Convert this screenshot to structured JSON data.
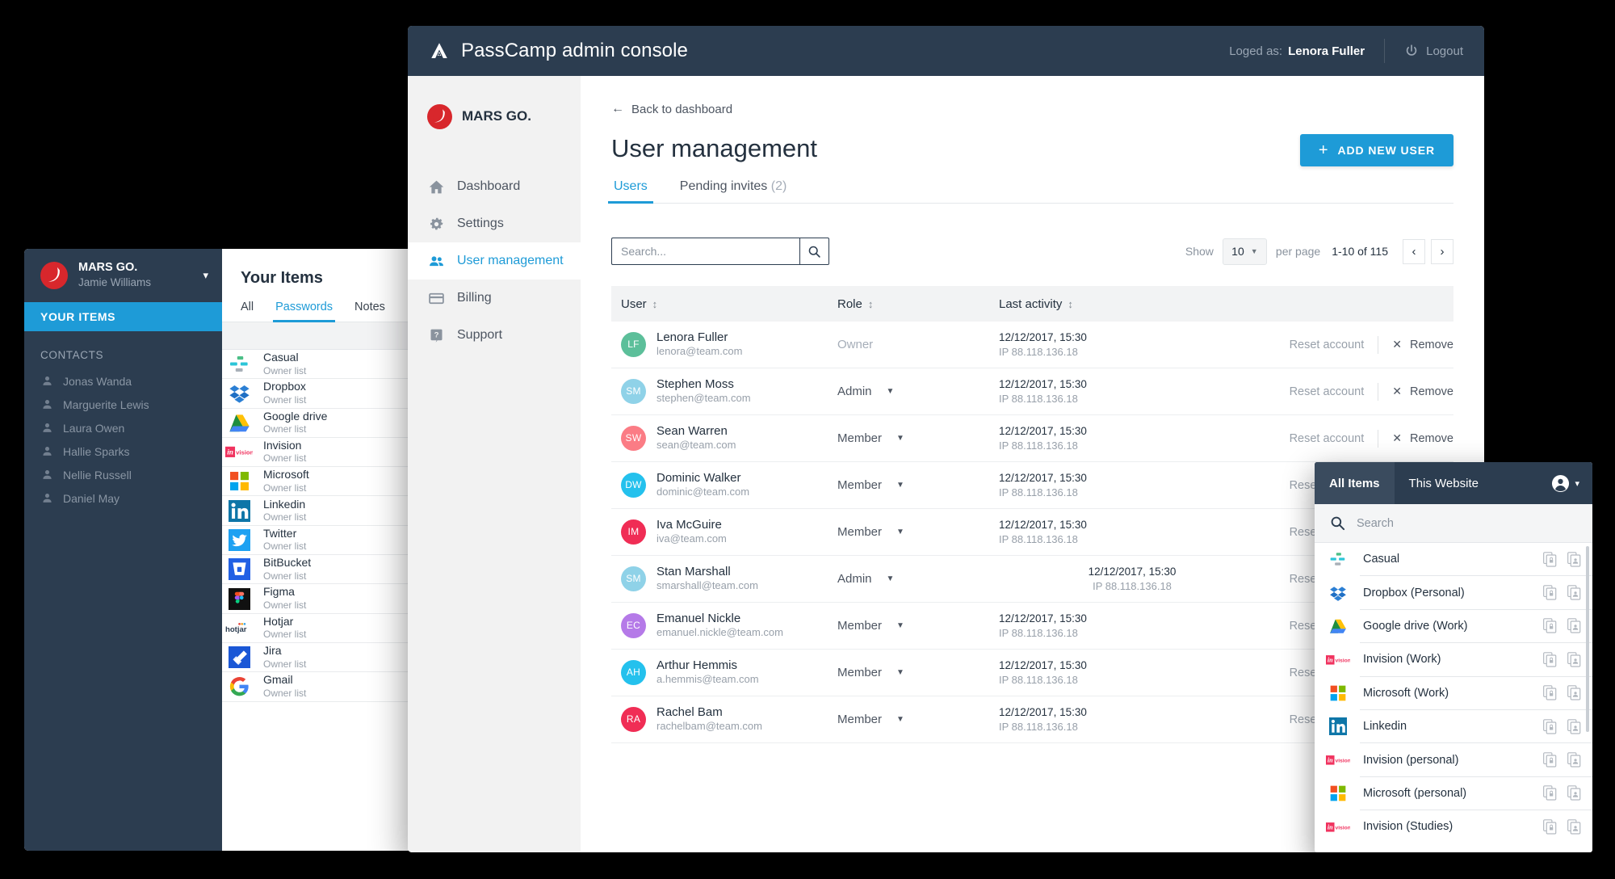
{
  "console": {
    "header": {
      "logo_icon": "passcamp-mountain-icon",
      "title": "PassCamp admin console",
      "logged_as_label": "Loged as:",
      "logged_user": "Lenora Fuller",
      "logout_label": "Logout",
      "logout_icon": "power-icon",
      "bg_color": "#2c3d50"
    },
    "sidebar": {
      "brand_name": "MARS GO.",
      "brand_logo_icon": "mars-go-logo-icon",
      "items": [
        {
          "label": "Dashboard",
          "icon": "home-icon",
          "active": false
        },
        {
          "label": "Settings",
          "icon": "gear-icon",
          "active": false
        },
        {
          "label": "User management",
          "icon": "users-icon",
          "active": true
        },
        {
          "label": "Billing",
          "icon": "credit-card-icon",
          "active": false
        },
        {
          "label": "Support",
          "icon": "question-box-icon",
          "active": false
        }
      ]
    },
    "main": {
      "back_link": "Back to dashboard",
      "back_icon": "arrow-left-icon",
      "page_title": "User management",
      "add_user_label": "ADD NEW USER",
      "add_user_icon": "plus-icon",
      "accent_color": "#1e9bd7",
      "tabs": [
        {
          "label": "Users",
          "count": "",
          "active": true
        },
        {
          "label": "Pending invites",
          "count": "(2)",
          "active": false
        }
      ],
      "search_placeholder": "Search...",
      "search_value": "",
      "search_icon": "search-icon",
      "show_label": "Show",
      "per_page_value": "10",
      "per_page_label": "per page",
      "range_label": "1-10 of 115",
      "prev_icon": "chevron-left-icon",
      "next_icon": "chevron-right-icon",
      "table": {
        "columns": [
          "User",
          "Role",
          "Last activity"
        ],
        "sort_icon": "sort-updown-icon",
        "reset_label": "Reset account",
        "remove_label": "Remove",
        "remove_icon": "x-icon",
        "rows": [
          {
            "initials": "LF",
            "color": "#5cbf9a",
            "name": "Lenora Fuller",
            "email": "lenora@team.com",
            "role": "Owner",
            "role_editable": false,
            "date": "12/12/2017, 15:30",
            "ip": "IP 88.118.136.18"
          },
          {
            "initials": "SM",
            "color": "#8fd2e8",
            "name": "Stephen Moss",
            "email": "stephen@team.com",
            "role": "Admin",
            "role_editable": true,
            "date": "12/12/2017, 15:30",
            "ip": "IP 88.118.136.18"
          },
          {
            "initials": "SW",
            "color": "#fb7c85",
            "name": "Sean Warren",
            "email": "sean@team.com",
            "role": "Member",
            "role_editable": true,
            "date": "12/12/2017, 15:30",
            "ip": "IP 88.118.136.18"
          },
          {
            "initials": "DW",
            "color": "#24c1ed",
            "name": "Dominic Walker",
            "email": "dominic@team.com",
            "role": "Member",
            "role_editable": true,
            "date": "12/12/2017, 15:30",
            "ip": "IP 88.118.136.18"
          },
          {
            "initials": "IM",
            "color": "#f02d55",
            "name": "Iva McGuire",
            "email": "iva@team.com",
            "role": "Member",
            "role_editable": true,
            "date": "12/12/2017, 15:30",
            "ip": "IP 88.118.136.18"
          },
          {
            "initials": "SM",
            "color": "#8fd2e8",
            "name": "Stan Marshall",
            "email": "smarshall@team.com",
            "role": "Admin",
            "role_editable": true,
            "date": "12/12/2017, 15:30",
            "ip": "IP 88.118.136.18"
          },
          {
            "initials": "EC",
            "color": "#b57ae8",
            "name": "Emanuel Nickle",
            "email": "emanuel.nickle@team.com",
            "role": "Member",
            "role_editable": true,
            "date": "12/12/2017, 15:30",
            "ip": "IP 88.118.136.18"
          },
          {
            "initials": "AH",
            "color": "#24c1ed",
            "name": "Arthur Hemmis",
            "email": "a.hemmis@team.com",
            "role": "Member",
            "role_editable": true,
            "date": "12/12/2017, 15:30",
            "ip": "IP 88.118.136.18"
          },
          {
            "initials": "RA",
            "color": "#f02d55",
            "name": "Rachel Bam",
            "email": "rachelbam@team.com",
            "role": "Member",
            "role_editable": true,
            "date": "12/12/2017, 15:30",
            "ip": "IP 88.118.136.18"
          }
        ]
      }
    }
  },
  "vault": {
    "account": {
      "org": "MARS GO.",
      "user": "Jamie Williams",
      "chevron_icon": "chevron-down-icon",
      "logo_icon": "mars-go-logo-icon"
    },
    "your_items_label": "YOUR ITEMS",
    "contacts_title": "CONTACTS",
    "contacts": [
      {
        "name": "Jonas Wanda"
      },
      {
        "name": "Marguerite Lewis"
      },
      {
        "name": "Laura Owen"
      },
      {
        "name": "Hallie Sparks"
      },
      {
        "name": "Nellie Russell"
      },
      {
        "name": "Daniel May"
      }
    ],
    "title": "Your Items",
    "tabs": [
      {
        "label": "All",
        "active": false
      },
      {
        "label": "Passwords",
        "active": true
      },
      {
        "label": "Notes",
        "active": false
      }
    ],
    "items": [
      {
        "name": "Casual",
        "sub": "Owner list",
        "icon": "casual-icon"
      },
      {
        "name": "Dropbox",
        "sub": "Owner list",
        "icon": "dropbox-icon"
      },
      {
        "name": "Google drive",
        "sub": "Owner list",
        "icon": "google-drive-icon"
      },
      {
        "name": "Invision",
        "sub": "Owner list",
        "icon": "invision-icon"
      },
      {
        "name": "Microsoft",
        "sub": "Owner list",
        "icon": "microsoft-icon"
      },
      {
        "name": "Linkedin",
        "sub": "Owner list",
        "icon": "linkedin-icon"
      },
      {
        "name": "Twitter",
        "sub": "Owner list",
        "icon": "twitter-icon"
      },
      {
        "name": "BitBucket",
        "sub": "Owner list",
        "icon": "bitbucket-icon"
      },
      {
        "name": "Figma",
        "sub": "Owner list",
        "icon": "figma-icon"
      },
      {
        "name": "Hotjar",
        "sub": "Owner list",
        "icon": "hotjar-icon"
      },
      {
        "name": "Jira",
        "sub": "Owner list",
        "icon": "jira-icon"
      },
      {
        "name": "Gmail",
        "sub": "Owner list",
        "icon": "gmail-icon"
      }
    ]
  },
  "extension": {
    "tabs": [
      {
        "label": "All Items",
        "active": true
      },
      {
        "label": "This Website",
        "active": false
      }
    ],
    "user_icon": "person-circle-icon",
    "user_chevron_icon": "chevron-down-icon",
    "search_placeholder": "Search",
    "search_value": "",
    "search_icon": "search-icon",
    "copy_password_icon": "copy-lock-icon",
    "copy_username_icon": "copy-user-icon",
    "items": [
      {
        "name": "Casual",
        "icon": "casual-icon"
      },
      {
        "name": "Dropbox (Personal)",
        "icon": "dropbox-icon"
      },
      {
        "name": "Google drive (Work)",
        "icon": "google-drive-icon"
      },
      {
        "name": "Invision (Work)",
        "icon": "invision-icon"
      },
      {
        "name": "Microsoft (Work)",
        "icon": "microsoft-icon"
      },
      {
        "name": "Linkedin",
        "icon": "linkedin-icon"
      },
      {
        "name": "Invision (personal)",
        "icon": "invision-icon"
      },
      {
        "name": "Microsoft (personal)",
        "icon": "microsoft-icon"
      },
      {
        "name": "Invision (Studies)",
        "icon": "invision-icon"
      }
    ]
  }
}
